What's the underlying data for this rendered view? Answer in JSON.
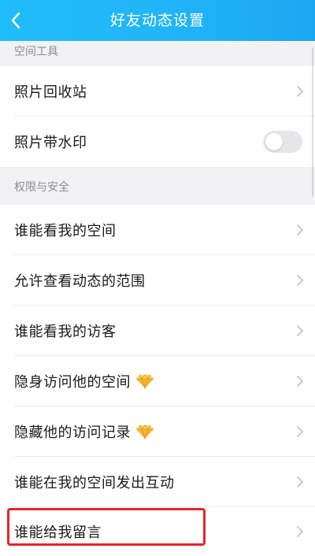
{
  "header": {
    "title": "好友动态设置",
    "back_icon": "chevron-left-icon"
  },
  "sections": [
    {
      "title": "空间工具",
      "items": [
        {
          "label": "照片回收站",
          "type": "link"
        },
        {
          "label": "照片带水印",
          "type": "toggle",
          "on": false
        }
      ]
    },
    {
      "title": "权限与安全",
      "items": [
        {
          "label": "谁能看我的空间",
          "type": "link"
        },
        {
          "label": "允许查看动态的范围",
          "type": "link"
        },
        {
          "label": "谁能看我的访客",
          "type": "link"
        },
        {
          "label": "隐身访问他的空间",
          "type": "link",
          "badge": "diamond-icon"
        },
        {
          "label": "隐藏他的访问记录",
          "type": "link",
          "badge": "diamond-icon"
        },
        {
          "label": "谁能在我的空间发出互动",
          "type": "link"
        },
        {
          "label": "谁能给我留言",
          "type": "link",
          "highlighted": true
        }
      ]
    }
  ],
  "colors": {
    "header": "#22b5f7",
    "highlight": "#e3262a",
    "diamond": "#f5b531"
  }
}
